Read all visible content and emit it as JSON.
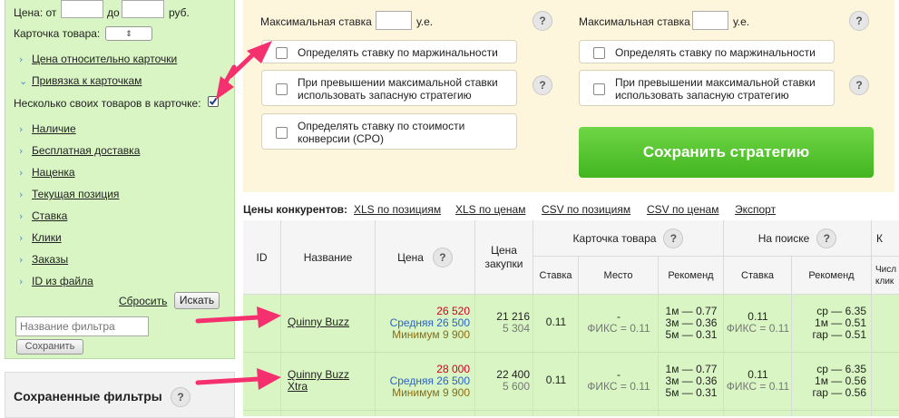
{
  "filters": {
    "price_label": "Цена: от",
    "price_to_label": "до",
    "price_currency": "руб.",
    "card_label": "Карточка товара:",
    "card_select_glyph": "⇕",
    "card_link_1": "Цена относительно карточки",
    "card_link_2": "Привязка к карточкам",
    "multi_label": "Несколько своих товаров в карточке:",
    "nav_items": [
      "Наличие",
      "Бесплатная доставка",
      "Наценка",
      "Текущая позиция",
      "Ставка",
      "Клики",
      "Заказы",
      "ID из файла"
    ],
    "reset_label": "Сбросить",
    "search_label": "Искать",
    "filter_name_placeholder": "Название фильтра",
    "save_label": "Сохранить",
    "saved_title": "Сохраненные фильтры"
  },
  "strategy": {
    "left": {
      "max_bid_label": "Максимальная ставка",
      "unit": "у.е.",
      "opt1": "Определять ставку по маржинальности",
      "opt2_l1": "При превышении максимальной ставки",
      "opt2_l2": "использовать запасную стратегию",
      "opt3_l1": "Определять ставку по стоимости",
      "opt3_l2": "конверсии (CPO)"
    },
    "right": {
      "max_bid_label": "Максимальная ставка",
      "unit": "у.е.",
      "opt1": "Определять ставку по маржинальности",
      "opt2_l1": "При превышении максимальной ставки",
      "opt2_l2": "использовать запасную стратегию"
    },
    "save_button": "Сохранить стратегию",
    "help": "?"
  },
  "competitors": {
    "label": "Цены конкурентов:",
    "links": [
      "XLS по позициям",
      "XLS по ценам",
      "CSV по позициям",
      "CSV по ценам",
      "Экспорт"
    ]
  },
  "table": {
    "headers": {
      "id": "ID",
      "name": "Название",
      "price": "Цена",
      "purchase_l1": "Цена",
      "purchase_l2": "закупки",
      "card": "Карточка товара",
      "search": "На поиске",
      "extra": "К",
      "bid": "Ставка",
      "place": "Место",
      "rec": "Рекоменд",
      "search_bid": "Ставка",
      "search_rec": "Рекоменд",
      "clicks_l1": "Числ",
      "clicks_l2": "клик"
    },
    "rows": [
      {
        "name_l1": "Quinny Buzz",
        "name_l2": "",
        "price": "26 520",
        "avg_label": "Средняя",
        "avg": "26 500",
        "min_label": "Минимум",
        "min": "9 900",
        "purchase": "21 216",
        "purchase2": "5 304",
        "bid": "0.11",
        "place": "-",
        "place_fix": "ФИКС = 0.11",
        "rec": [
          "1м — 0.77",
          "3м — 0.36",
          "5м — 0.31"
        ],
        "search_bid": "0.11",
        "search_fix": "ФИКС = 0.11",
        "search_rec": [
          "ср — 6.35",
          "1м — 0.51",
          "гар — 0.51"
        ]
      },
      {
        "name_l1": "Quinny Buzz",
        "name_l2": "Xtra",
        "price": "28 000",
        "avg_label": "Средняя",
        "avg": "26 500",
        "min_label": "Минимум",
        "min": "9 900",
        "purchase": "22 400",
        "purchase2": "5 600",
        "bid": "0.11",
        "place": "-",
        "place_fix": "ФИКС = 0.11",
        "rec": [
          "1м — 0.77",
          "3м — 0.36",
          "5м — 0.31"
        ],
        "search_bid": "0.11",
        "search_fix": "ФИКС = 0.11",
        "search_rec": [
          "ср — 6.35",
          "1м — 0.56",
          "гар — 0.56"
        ]
      }
    ]
  },
  "colors": {
    "price_red": "#d0021b",
    "avg_blue": "#2a63c8",
    "min_olive": "#8a6d14",
    "annotation_arrow": "#f5306e",
    "save_green": "#4cbd27"
  }
}
